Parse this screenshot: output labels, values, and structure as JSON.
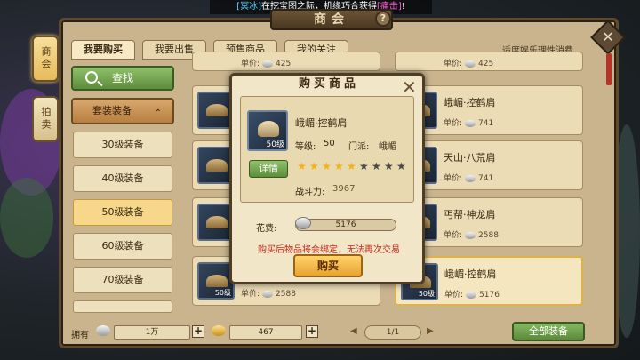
{
  "announcement": {
    "prefix_tag": "[冥冰]",
    "text": "在挖宝图之际，机缘巧合获得",
    "item_tag": "[痛击]",
    "suffix": "!"
  },
  "window": {
    "title": "商会",
    "help_label": "?",
    "close_label": "✕"
  },
  "side_plaques": [
    {
      "label": "商会",
      "active": true
    },
    {
      "label": "拍卖",
      "active": false
    }
  ],
  "tabs": [
    {
      "label": "我要购买"
    },
    {
      "label": "我要出售"
    },
    {
      "label": "预售商品"
    },
    {
      "label": "我的关注"
    }
  ],
  "slogan": "适度娱乐理性消费",
  "left_panel": {
    "search_label": "查找",
    "category_label": "套装装备",
    "category_chevron": "⌃",
    "levels": [
      "30级装备",
      "40级装备",
      "50级装备",
      "60级装备",
      "70级装备"
    ]
  },
  "listings": [
    {
      "name": "",
      "level": "50级",
      "price_label": "单价:",
      "price": "425"
    },
    {
      "name": "",
      "level": "",
      "price_label": "单价:",
      "price": "425"
    },
    {
      "name": "",
      "level": "",
      "price_label": "",
      "price": ""
    },
    {
      "name": "峨嵋·控鹤肩",
      "level": "",
      "price_label": "单价:",
      "price": "741"
    },
    {
      "name": "",
      "level": "",
      "price_label": "",
      "price": ""
    },
    {
      "name": "天山·八荒肩",
      "level": "",
      "price_label": "单价:",
      "price": "741"
    },
    {
      "name": "",
      "level": "",
      "price_label": "",
      "price": ""
    },
    {
      "name": "丐帮·神龙肩",
      "level": "",
      "price_label": "单价:",
      "price": "2588"
    },
    {
      "name": "",
      "level": "50级",
      "price_label": "单价:",
      "price": "2588"
    },
    {
      "name": "峨嵋·控鹤肩",
      "level": "50级",
      "price_label": "单价:",
      "price": "5176"
    }
  ],
  "bottom_bar": {
    "own_label": "拥有",
    "silver_amount": "1万",
    "gold_amount": "467",
    "plus_label": "+",
    "page": "1/1",
    "prev_arrow": "◀",
    "next_arrow": "▶",
    "all_label": "全部装备"
  },
  "dialog": {
    "title": "购买商品",
    "close_label": "✕",
    "item_name": "峨嵋·控鹤肩",
    "item_level_badge": "50级",
    "level_label": "等级:",
    "level_value": "50",
    "school_label": "门派:",
    "school_value": "峨嵋",
    "detail_label": "详情",
    "stars_filled": 5,
    "stars_total": 9,
    "power_label": "战斗力:",
    "power_value": "3967",
    "fee_label": "花费:",
    "fee_value": "5176",
    "bind_note": "购买后物品将会绑定，无法再次交易",
    "buy_label": "购买",
    "star_gold_color": "#f2b01a",
    "star_empty_color": "#4a4a4a"
  }
}
